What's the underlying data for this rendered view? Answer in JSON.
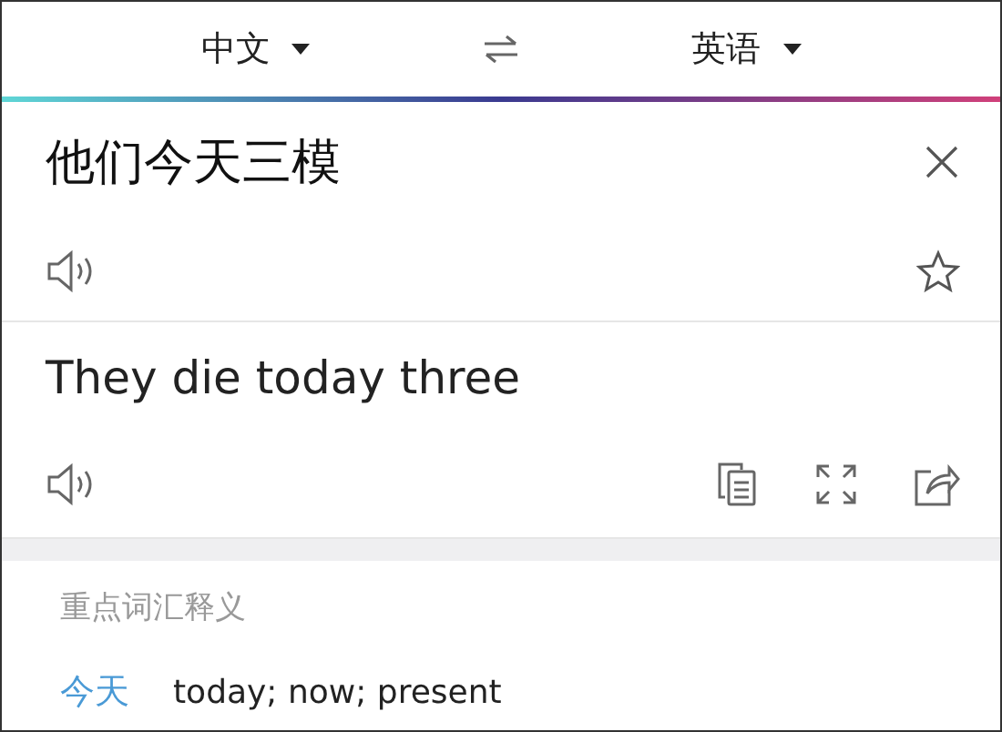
{
  "language_bar": {
    "source": "中文",
    "target": "英语"
  },
  "input": {
    "text": "他们今天三模"
  },
  "output": {
    "text": "They die today three"
  },
  "vocabulary": {
    "title": "重点词汇释义",
    "entries": [
      {
        "word": "今天",
        "meaning": "today; now; present"
      }
    ]
  }
}
